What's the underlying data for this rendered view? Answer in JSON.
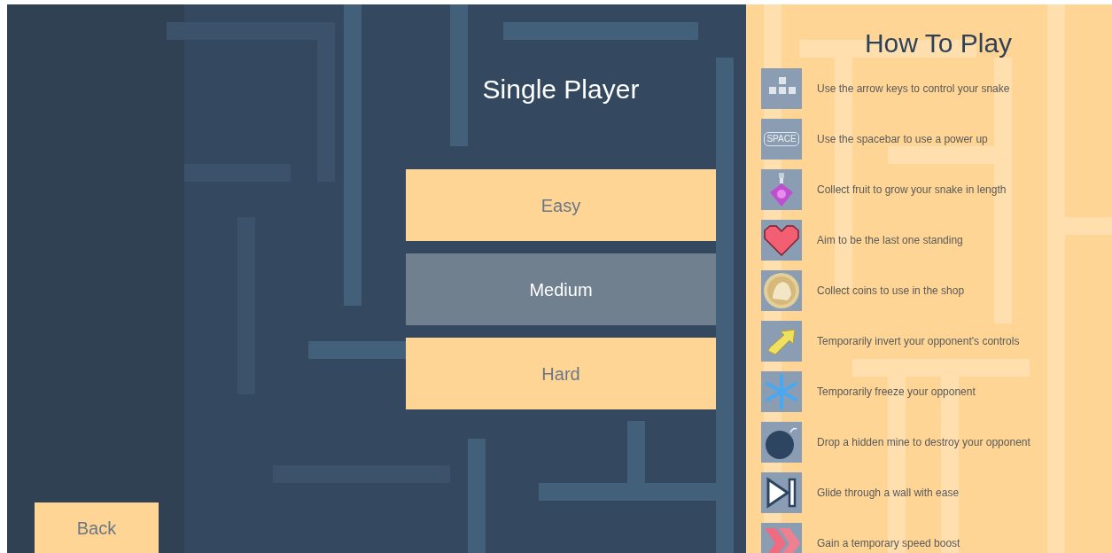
{
  "title": "Single Player",
  "difficulty_buttons": [
    {
      "label": "Easy",
      "selected": false
    },
    {
      "label": "Medium",
      "selected": true
    },
    {
      "label": "Hard",
      "selected": false
    }
  ],
  "back_button": "Back",
  "how_to_play": {
    "title": "How To Play",
    "items": [
      {
        "kind": "arrows",
        "text": "Use the arrow keys to control your snake"
      },
      {
        "kind": "spacebar",
        "icon_text": "SPACE",
        "text": "Use the spacebar to use a power up"
      },
      {
        "kind": "potion",
        "text": "Collect fruit to grow your snake in length"
      },
      {
        "kind": "heart",
        "text": "Aim to be the last one standing"
      },
      {
        "kind": "coin",
        "text": "Collect coins to use in the shop"
      },
      {
        "kind": "swap",
        "text": "Temporarily invert your opponent's controls"
      },
      {
        "kind": "snowflake",
        "text": "Temporarily freeze your opponent"
      },
      {
        "kind": "bomb",
        "text": "Drop a hidden mine to destroy your opponent"
      },
      {
        "kind": "skip",
        "text": "Glide through a wall with ease"
      },
      {
        "kind": "boost",
        "text": "Gain a temporary speed boost"
      }
    ]
  }
}
